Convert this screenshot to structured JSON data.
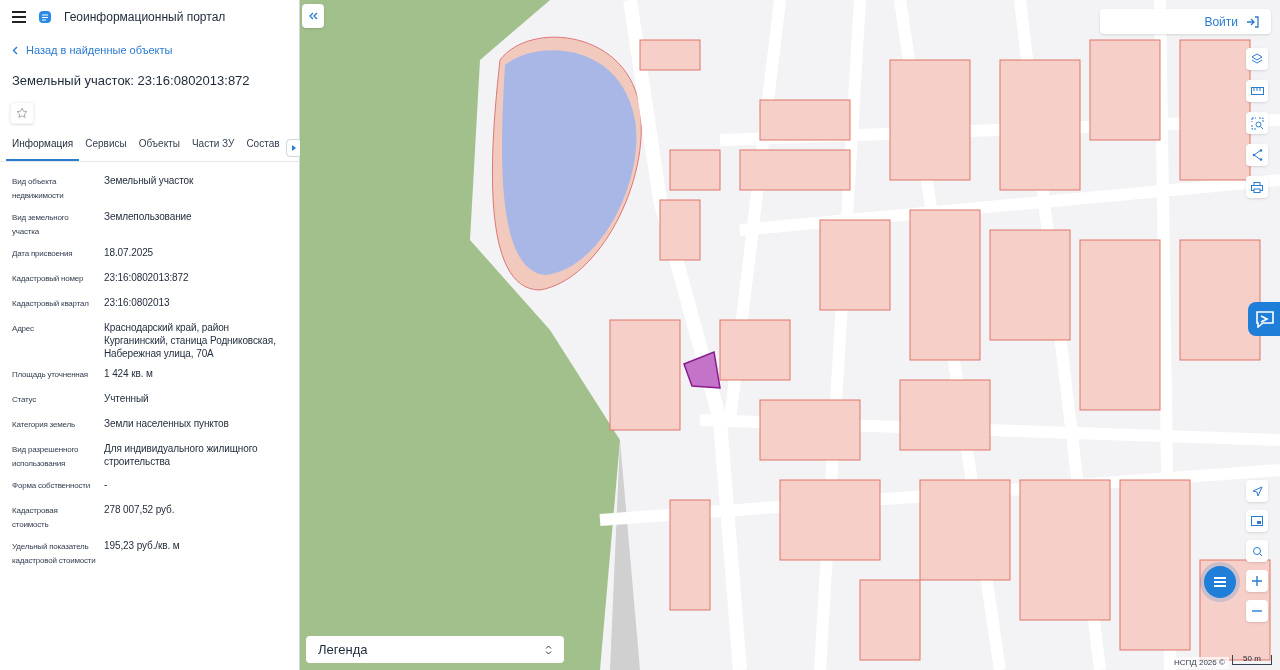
{
  "header": {
    "title": "Геоинформационный портал"
  },
  "back_link": "Назад в найденные объекты",
  "object_title": "Земельный участок: 23:16:0802013:872",
  "favorite": {
    "on": false
  },
  "tabs": [
    {
      "label": "Информация",
      "selected": true
    },
    {
      "label": "Сервисы",
      "selected": false
    },
    {
      "label": "Объекты",
      "selected": false
    },
    {
      "label": "Части ЗУ",
      "selected": false
    },
    {
      "label": "Состав",
      "selected": false
    }
  ],
  "properties": [
    {
      "label": "Вид объекта недвижимости",
      "value": "Земельный участок"
    },
    {
      "label": "Вид земельного участка",
      "value": "Землепользование"
    },
    {
      "label": "Дата присвоения",
      "value": "18.07.2025"
    },
    {
      "label": "Кадастровый номер",
      "value": "23:16:0802013:872"
    },
    {
      "label": "Кадастровый квартал",
      "value": "23:16:0802013"
    },
    {
      "label": "Адрес",
      "value": "Краснодарский край, район Курганинский, станица Родниковская, Набережная улица, 70А"
    },
    {
      "label": "Площадь уточненная",
      "value": "1 424 кв. м"
    },
    {
      "label": "Статус",
      "value": "Учтенный"
    },
    {
      "label": "Категория земель",
      "value": "Земли населенных пунктов"
    },
    {
      "label": "Вид разрешенного использования",
      "value": "Для индивидуального жилищного строительства"
    },
    {
      "label": "Форма собственности",
      "value": "-"
    },
    {
      "label": "Кадастровая стоимость",
      "value": "278 007,52 руб."
    },
    {
      "label": "Удельный показатель кадастровой стоимости",
      "value": "195,23 руб./кв. м"
    }
  ],
  "map": {
    "login_button": "Войти",
    "legend": "Легенда",
    "attribution": "НСПД 2026 ©",
    "scale": "50 m"
  }
}
